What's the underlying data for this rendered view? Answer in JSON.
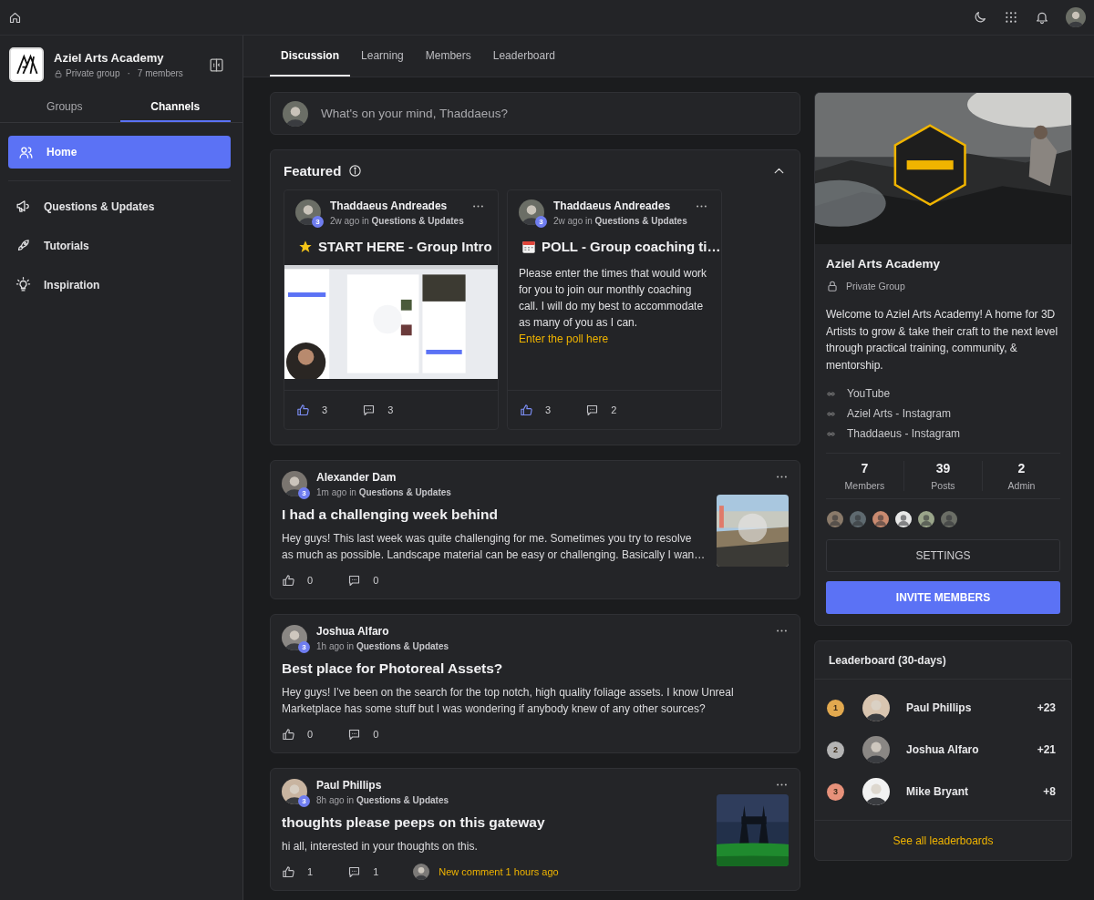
{
  "group": {
    "name": "Aziel Arts Academy",
    "privacy": "Private group",
    "separator": "·",
    "members": "7 members"
  },
  "sidebar_tabs": [
    {
      "label": "Groups",
      "selected": false
    },
    {
      "label": "Channels",
      "selected": true
    }
  ],
  "sidebar_items": [
    {
      "label": "Home",
      "kind": "users",
      "selected": true
    },
    {
      "label": "Questions & Updates",
      "kind": "megaphone",
      "selected": false
    },
    {
      "label": "Tutorials",
      "kind": "rocket",
      "selected": false
    },
    {
      "label": "Inspiration",
      "kind": "bulb",
      "selected": false
    }
  ],
  "tabs": [
    {
      "label": "Discussion",
      "selected": true
    },
    {
      "label": "Learning",
      "selected": false
    },
    {
      "label": "Members",
      "selected": false
    },
    {
      "label": "Leaderboard",
      "selected": false
    }
  ],
  "composer": {
    "placeholder": "What's on your mind, Thaddaeus?"
  },
  "featured": {
    "title": "Featured",
    "expanded": true,
    "posts": [
      {
        "kind": "video",
        "author": "Thaddaeus Andreades",
        "rank": "3",
        "meta": "2w ago in **Questions & Updates**",
        "title_icon": {
          "kind": "star"
        },
        "title": "START HERE - Group Intro",
        "likes": "3",
        "comments": "3",
        "liked": true
      },
      {
        "kind": "text",
        "author": "Thaddaeus Andreades",
        "rank": "3",
        "meta": "2w ago in **Questions & Updates**",
        "title_icon": {
          "kind": "calendar"
        },
        "title": "POLL - Group coaching ti…",
        "body": "Please enter the times that would work for you to join our monthly coaching call. I will do my best to accommodate as many of you as I can.",
        "link": "Enter the poll here",
        "likes": "3",
        "comments": "2",
        "liked": true
      }
    ]
  },
  "posts": [
    {
      "author": "Alexander Dam",
      "rank": "3",
      "meta": "1m ago in **Questions & Updates**",
      "title": "I had a challenging week behind",
      "body": "Hey guys! This last week was quite challenging for me. Sometimes you try to resolve as much as possible. Landscape material can be easy or challenging. Basically I wan…",
      "likes": "0",
      "comments": "0",
      "liked": false
    },
    {
      "kind": "text",
      "author": "Joshua Alfaro",
      "rank": "3",
      "meta": "1h ago in **Questions & Updates**",
      "title": "Best place for Photoreal Assets?",
      "body": "Hey guys! I’ve been on the search for the top notch, high quality foliage assets. I know Unreal Marketplace has some stuff but I was wondering if anybody knew of any other sources?",
      "likes": "0",
      "comments": "0",
      "liked": false
    },
    {
      "author": "Paul Phillips",
      "rank": "3",
      "meta": "8h ago in **Questions & Updates**",
      "title": "thoughts please peeps on this gateway",
      "body": "hi all, interested in your thoughts on this.",
      "likes": "1",
      "comments": "1",
      "liked": false,
      "new_comment": "New comment 1 hours ago"
    }
  ],
  "group_card": {
    "name": "Aziel Arts Academy",
    "privacy": "Private Group",
    "description": "Welcome to Aziel Arts Academy! A home for 3D Artists to grow & take their craft to the next level through practical training, community, & mentorship.",
    "links": [
      "YouTube",
      "Aziel Arts - Instagram",
      "Thaddaeus - Instagram"
    ],
    "stats": [
      {
        "value": "7",
        "label": "Members"
      },
      {
        "value": "39",
        "label": "Posts"
      },
      {
        "value": "2",
        "label": "Admin"
      }
    ],
    "member_avatars": [
      {
        "color": "#8a7a6a"
      },
      {
        "color": "#5f6a70"
      },
      {
        "color": "#c98a70"
      },
      {
        "color": "#e8e8e8"
      },
      {
        "color": "#9aa58a"
      },
      {
        "color": "#6b6e66"
      }
    ],
    "buttons": [
      {
        "label": "SETTINGS",
        "kind": "secondary"
      },
      {
        "label": "INVITE MEMBERS",
        "kind": "primary"
      }
    ]
  },
  "leaderboard": {
    "title": "Leaderboard (30-days)",
    "entries": [
      {
        "rank": "1",
        "color": "#e2a94f",
        "name": "Paul Phillips",
        "points": "+23"
      },
      {
        "rank": "2",
        "color": "#b4b4b4",
        "name": "Joshua Alfaro",
        "points": "+21"
      },
      {
        "rank": "3",
        "color": "#e7917a",
        "name": "Mike Bryant",
        "points": "+8"
      }
    ],
    "footer": "See all leaderboards"
  }
}
